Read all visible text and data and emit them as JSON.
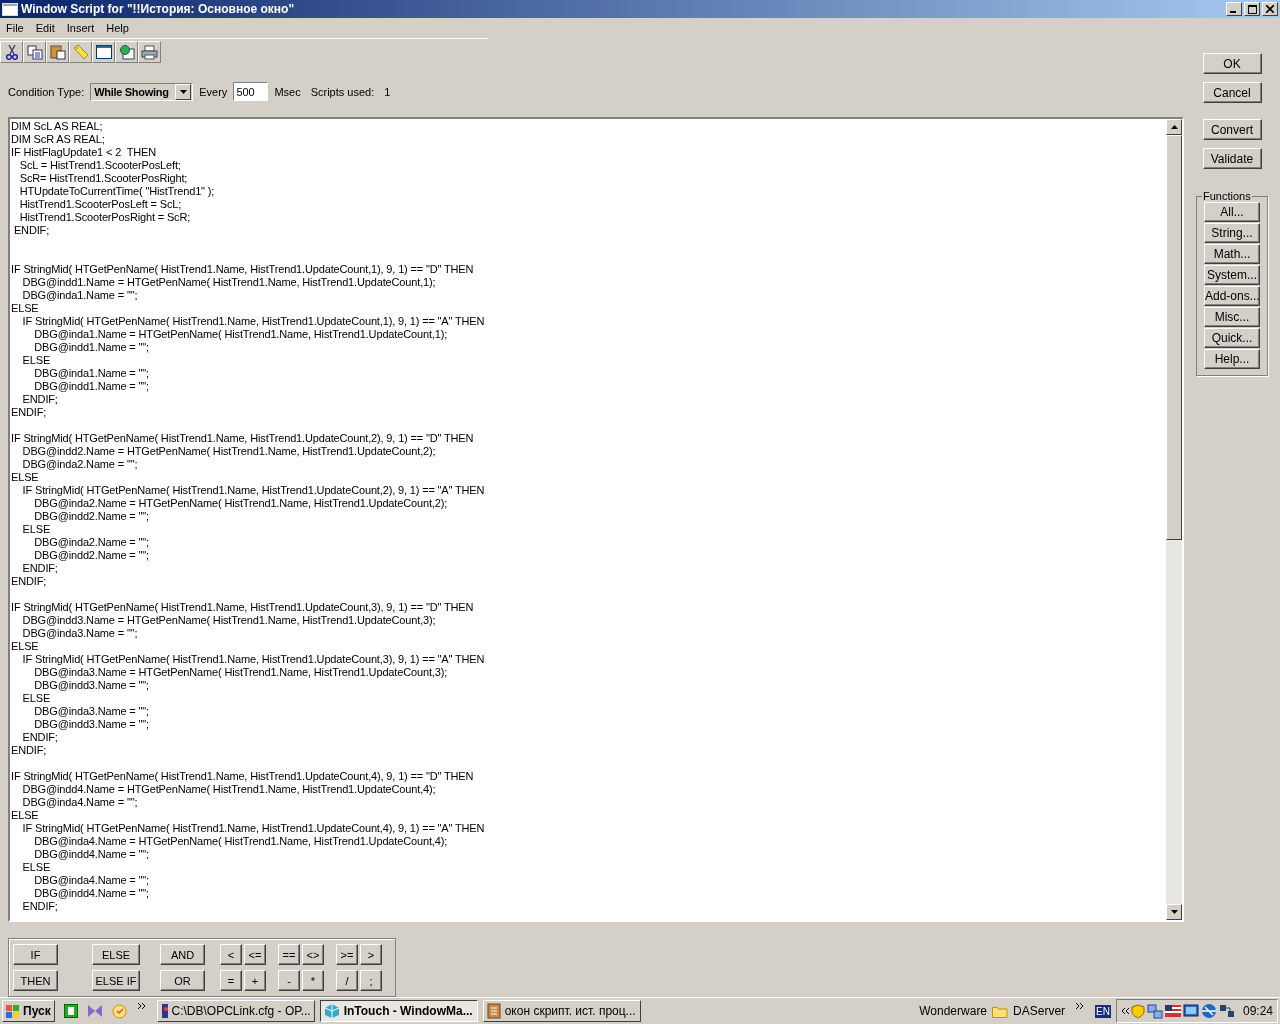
{
  "window": {
    "title": "Window Script for \"!!История: Основное окно\""
  },
  "menu": [
    "File",
    "Edit",
    "Insert",
    "Help"
  ],
  "toolbar": [
    {
      "kind": "cut"
    },
    {
      "kind": "copy"
    },
    {
      "kind": "paste"
    },
    {
      "kind": "tag"
    },
    {
      "kind": "window"
    },
    {
      "kind": "link"
    },
    {
      "kind": "print"
    }
  ],
  "condition": {
    "label": "Condition Type:",
    "value": "While Showing",
    "every_label": "Every",
    "every_value": "500",
    "unit": "Msec",
    "scripts_used_label": "Scripts used:",
    "scripts_used": "1"
  },
  "code_blocks": [
    {
      "lines": [
        "DIM ScL AS REAL;",
        "DIM ScR AS REAL;",
        "IF HistFlagUpdate1 < 2  THEN",
        "   ScL = HistTrend1.ScooterPosLeft;",
        "   ScR= HistTrend1.ScooterPosRight;",
        "   HTUpdateToCurrentTime( \"HistTrend1\" );",
        "   HistTrend1.ScooterPosLeft = ScL;",
        "   HistTrend1.ScooterPosRight = ScR;",
        " ENDIF;"
      ]
    },
    {
      "lines": [
        "IF StringMid( HTGetPenName( HistTrend1.Name, HistTrend1.UpdateCount,1), 9, 1) == \"D\" THEN",
        "    DBG@indd1.Name = HTGetPenName( HistTrend1.Name, HistTrend1.UpdateCount,1);",
        "    DBG@inda1.Name = \"\";",
        "ELSE",
        "    IF StringMid( HTGetPenName( HistTrend1.Name, HistTrend1.UpdateCount,1), 9, 1) == \"A\" THEN",
        "        DBG@inda1.Name = HTGetPenName( HistTrend1.Name, HistTrend1.UpdateCount,1);",
        "        DBG@indd1.Name = \"\";",
        "    ELSE",
        "        DBG@inda1.Name = \"\";",
        "        DBG@indd1.Name = \"\";",
        "    ENDIF;",
        "ENDIF;"
      ]
    },
    {
      "lines": [
        "IF StringMid( HTGetPenName( HistTrend1.Name, HistTrend1.UpdateCount,2), 9, 1) == \"D\" THEN",
        "    DBG@indd2.Name = HTGetPenName( HistTrend1.Name, HistTrend1.UpdateCount,2);",
        "    DBG@inda2.Name = \"\";",
        "ELSE",
        "    IF StringMid( HTGetPenName( HistTrend1.Name, HistTrend1.UpdateCount,2), 9, 1) == \"A\" THEN",
        "        DBG@inda2.Name = HTGetPenName( HistTrend1.Name, HistTrend1.UpdateCount,2);",
        "        DBG@indd2.Name = \"\";",
        "    ELSE",
        "        DBG@inda2.Name = \"\";",
        "        DBG@indd2.Name = \"\";",
        "    ENDIF;",
        "ENDIF;"
      ]
    },
    {
      "lines": [
        "IF StringMid( HTGetPenName( HistTrend1.Name, HistTrend1.UpdateCount,3), 9, 1) == \"D\" THEN",
        "    DBG@indd3.Name = HTGetPenName( HistTrend1.Name, HistTrend1.UpdateCount,3);",
        "    DBG@inda3.Name = \"\";",
        "ELSE",
        "    IF StringMid( HTGetPenName( HistTrend1.Name, HistTrend1.UpdateCount,3), 9, 1) == \"A\" THEN",
        "        DBG@inda3.Name = HTGetPenName( HistTrend1.Name, HistTrend1.UpdateCount,3);",
        "        DBG@indd3.Name = \"\";",
        "    ELSE",
        "        DBG@inda3.Name = \"\";",
        "        DBG@indd3.Name = \"\";",
        "    ENDIF;",
        "ENDIF;"
      ]
    },
    {
      "lines": [
        "IF StringMid( HTGetPenName( HistTrend1.Name, HistTrend1.UpdateCount,4), 9, 1) == \"D\" THEN",
        "    DBG@indd4.Name = HTGetPenName( HistTrend1.Name, HistTrend1.UpdateCount,4);",
        "    DBG@inda4.Name = \"\";",
        "ELSE",
        "    IF StringMid( HTGetPenName( HistTrend1.Name, HistTrend1.UpdateCount,4), 9, 1) == \"A\" THEN",
        "        DBG@inda4.Name = HTGetPenName( HistTrend1.Name, HistTrend1.UpdateCount,4);",
        "        DBG@indd4.Name = \"\";",
        "    ELSE",
        "        DBG@inda4.Name = \"\";",
        "        DBG@indd4.Name = \"\";",
        "    ENDIF;"
      ]
    }
  ],
  "dialog_buttons": [
    [
      "OK",
      "Cancel"
    ],
    [
      "Convert",
      "Validate"
    ]
  ],
  "functions": {
    "title": "Functions",
    "buttons": [
      "All...",
      "String...",
      "Math...",
      "System...",
      "Add-ons...",
      "Misc...",
      "Quick...",
      "Help..."
    ]
  },
  "keypad": [
    [
      [
        "IF",
        "THEN"
      ]
    ],
    [
      [
        "ELSE",
        "ELSE IF"
      ]
    ],
    [
      [
        "AND",
        "OR"
      ]
    ],
    [
      [
        "<",
        "="
      ],
      [
        "<=",
        "+"
      ]
    ],
    [
      [
        "==",
        "-"
      ],
      [
        "<>",
        "*"
      ]
    ],
    [
      [
        ">=",
        "/"
      ],
      [
        ">",
        ";"
      ]
    ]
  ],
  "taskbar": {
    "start": "Пуск",
    "tasks": [
      {
        "label": "C:\\DB\\OPCLink.cfg - OP...",
        "selected": false
      },
      {
        "label": "InTouch - WindowMa...",
        "selected": true
      },
      {
        "label": "окон скрипт. ист. проц...",
        "selected": false
      }
    ],
    "toolbars": [
      "Wonderware",
      "DAServer"
    ],
    "language": "EN",
    "clock": "09:24"
  }
}
